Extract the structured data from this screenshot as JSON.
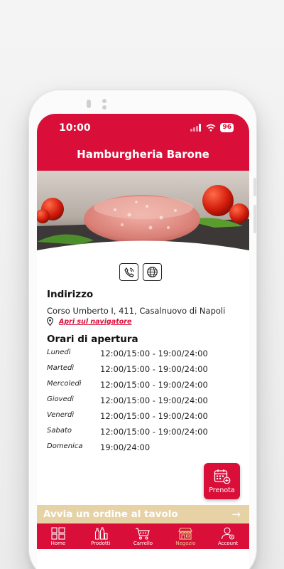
{
  "status_bar": {
    "time": "10:00",
    "battery": "96"
  },
  "header": {
    "title": "Hamburgheria Barone"
  },
  "contact": {
    "icons": [
      "phone-icon",
      "globe-icon"
    ]
  },
  "address_section": {
    "heading": "Indirizzo",
    "address": "Corso Umberto I, 411, Casalnuovo di Napoli",
    "navigator_link": "Apri sul navigatore"
  },
  "hours_section": {
    "heading": "Orari di apertura",
    "rows": [
      {
        "day": "Lunedì",
        "time": "12:00/15:00 - 19:00/24:00"
      },
      {
        "day": "Martedì",
        "time": "12:00/15:00 - 19:00/24:00"
      },
      {
        "day": "Mercoledì",
        "time": "12:00/15:00 - 19:00/24:00"
      },
      {
        "day": "Giovedì",
        "time": "12:00/15:00 - 19:00/24:00"
      },
      {
        "day": "Venerdì",
        "time": "12:00/15:00 - 19:00/24:00"
      },
      {
        "day": "Sabato",
        "time": "12:00/15:00 - 19:00/24:00"
      },
      {
        "day": "Domenica",
        "time": "19:00/24:00"
      }
    ]
  },
  "prenota_button": {
    "label": "Prenota"
  },
  "order_bar": {
    "label": "Avvia un ordine al tavolo",
    "arrow": "→"
  },
  "tabbar": {
    "items": [
      {
        "label": "Home",
        "icon": "home-grid-icon"
      },
      {
        "label": "Prodotti",
        "icon": "bottles-icon"
      },
      {
        "label": "Carrello",
        "icon": "cart-icon"
      },
      {
        "label": "Negozio",
        "icon": "store-icon",
        "active": true
      },
      {
        "label": "Account",
        "icon": "account-icon"
      }
    ]
  },
  "colors": {
    "brand_red": "#d90f3a",
    "order_bar": "#e6d2a4",
    "active_tab": "#e8c88a"
  }
}
